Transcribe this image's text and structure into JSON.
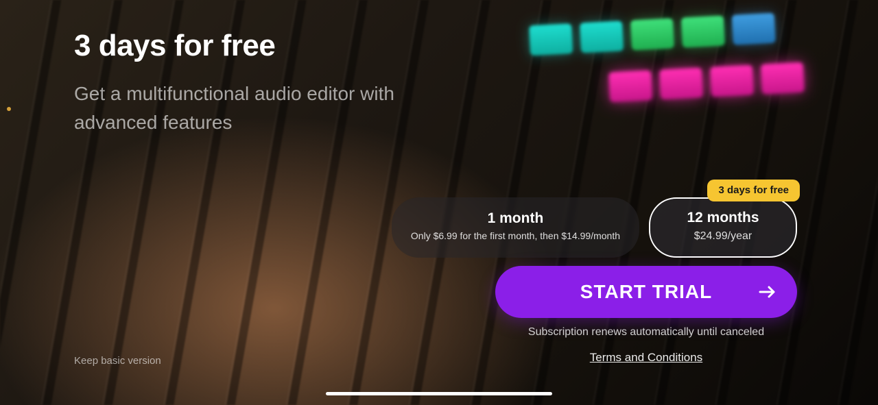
{
  "hero": {
    "headline": "3 days for free",
    "subhead": "Get a multifunctional audio editor with advanced features"
  },
  "plans": [
    {
      "title": "1 month",
      "sub": "Only $6.99 for the first month, then $14.99/month",
      "selected": false,
      "badge": null
    },
    {
      "title": "12 months",
      "sub": "$24.99/year",
      "selected": true,
      "badge": "3 days for free"
    }
  ],
  "cta": {
    "label": "START TRIAL"
  },
  "footer": {
    "renew_note": "Subscription renews automatically until canceled",
    "terms": "Terms and Conditions",
    "keep_basic": "Keep basic version"
  },
  "colors": {
    "accent": "#8b1fe8",
    "badge": "#f6c531"
  }
}
